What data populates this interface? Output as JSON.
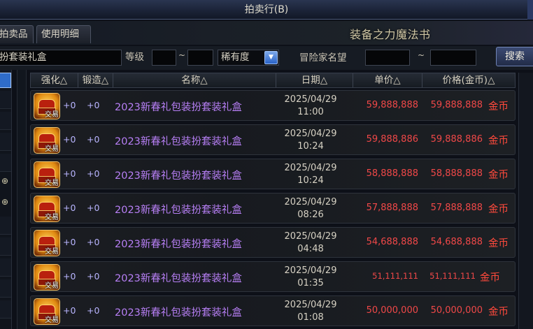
{
  "window": {
    "title": "拍卖行(B)"
  },
  "tabs": [
    {
      "label": "拍卖品"
    },
    {
      "label": "使用明细"
    }
  ],
  "banner_title": "装备之力魔法书",
  "search": {
    "name_value": "扮套装礼盒",
    "level_label": "等级",
    "level_separator": "~",
    "rarity_selected": "稀有度",
    "reputation_label": "冒险家名望",
    "reputation_separator": "~",
    "search_button": "搜索"
  },
  "columns": {
    "enhance": "强化△",
    "forge": "锻造△",
    "name": "名称△",
    "date": "日期△",
    "unit_price": "单价△",
    "price": "价格(金币)△"
  },
  "rows": [
    {
      "enhance": "+0",
      "forge": "+0",
      "name": "2023新春礼包装扮套装礼盒",
      "date": "2025/04/29",
      "time": "11:00",
      "unit_price": "59,888,888",
      "price": "59,888,888",
      "currency": "金币",
      "trade_badge": "交易"
    },
    {
      "enhance": "+0",
      "forge": "+0",
      "name": "2023新春礼包装扮套装礼盒",
      "date": "2025/04/29",
      "time": "10:24",
      "unit_price": "59,888,886",
      "price": "59,888,886",
      "currency": "金币",
      "trade_badge": "交易"
    },
    {
      "enhance": "+0",
      "forge": "+0",
      "name": "2023新春礼包装扮套装礼盒",
      "date": "2025/04/29",
      "time": "10:24",
      "unit_price": "58,888,888",
      "price": "58,888,888",
      "currency": "金币",
      "trade_badge": "交易"
    },
    {
      "enhance": "+0",
      "forge": "+0",
      "name": "2023新春礼包装扮套装礼盒",
      "date": "2025/04/29",
      "time": "08:26",
      "unit_price": "57,888,888",
      "price": "57,888,888",
      "currency": "金币",
      "trade_badge": "交易"
    },
    {
      "enhance": "+0",
      "forge": "+0",
      "name": "2023新春礼包装扮套装礼盒",
      "date": "2025/04/29",
      "time": "04:48",
      "unit_price": "54,688,888",
      "price": "54,688,888",
      "currency": "金币",
      "trade_badge": "交易"
    },
    {
      "enhance": "+0",
      "forge": "+0",
      "name": "2023新春礼包装扮套装礼盒",
      "date": "2025/04/29",
      "time": "01:35",
      "unit_price": "51,111,111",
      "price": "51,111,111",
      "currency": "金币",
      "trade_badge": "交易"
    },
    {
      "enhance": "+0",
      "forge": "+0",
      "name": "2023新春礼包装扮套装礼盒",
      "date": "2025/04/29",
      "time": "01:08",
      "unit_price": "50,000,000",
      "price": "50,000,000",
      "currency": "金币",
      "trade_badge": "交易"
    }
  ],
  "colors": {
    "price_red": "#f04848",
    "item_purple": "#b77ff5",
    "accent_blue": "#2f6cc9"
  },
  "icons": {
    "rarity_dropdown": "chevron-down-icon",
    "zoom": "zoom-in-icon",
    "item": "gift-chest-icon"
  }
}
